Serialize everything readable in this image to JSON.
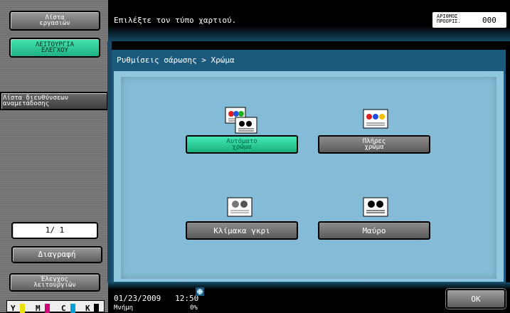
{
  "sidebar": {
    "job_list_label": "Λίστα\nεργασιών",
    "check_function_label": "ΛΕΙΤΟΥΡΓΙΑ\nΕΛΕΓΧΟΥ",
    "address_list_label": "Λίστα διευθύνσεων\nαναμετάδοσης",
    "page_counter": "1/ 1",
    "delete_label": "Διαγραφή",
    "check_job_label": "Έλεγχος\nλειτουργιών"
  },
  "header": {
    "instruction": "Επιλέξτε τον τύπο χαρτιού.",
    "counter_label": "ΑΡΙΘΜΟΣ\nΠΡΟΟΡΙΣ.",
    "counter_value": "000"
  },
  "breadcrumb": "Ρυθμίσεις σάρωσης > Χρώμα",
  "options": [
    {
      "label": "Αυτόματο\nχρώμα",
      "selected": true,
      "icon": "auto-color-icon"
    },
    {
      "label": "Πλήρες\nχρώμα",
      "selected": false,
      "icon": "full-color-icon"
    },
    {
      "label": "Κλίμακα γκρι",
      "selected": false,
      "icon": "grayscale-icon"
    },
    {
      "label": "Μαύρο",
      "selected": false,
      "icon": "black-icon"
    }
  ],
  "status": {
    "date": "01/23/2009",
    "time": "12:50",
    "memory_label": "Μνήμη",
    "memory_value": "0%",
    "ok_label": "OK"
  },
  "toner": [
    {
      "letter": "Y",
      "color": "#e8e000",
      "level": 0.9
    },
    {
      "letter": "M",
      "color": "#d0007a",
      "level": 0.9
    },
    {
      "letter": "C",
      "color": "#00a0d8",
      "level": 0.9
    },
    {
      "letter": "K",
      "color": "#000000",
      "level": 0.9
    }
  ],
  "colors": {
    "accent_green": "#2fd39c",
    "panel_blue": "#1b5a7c",
    "inner_blue": "#8fc7e0"
  }
}
